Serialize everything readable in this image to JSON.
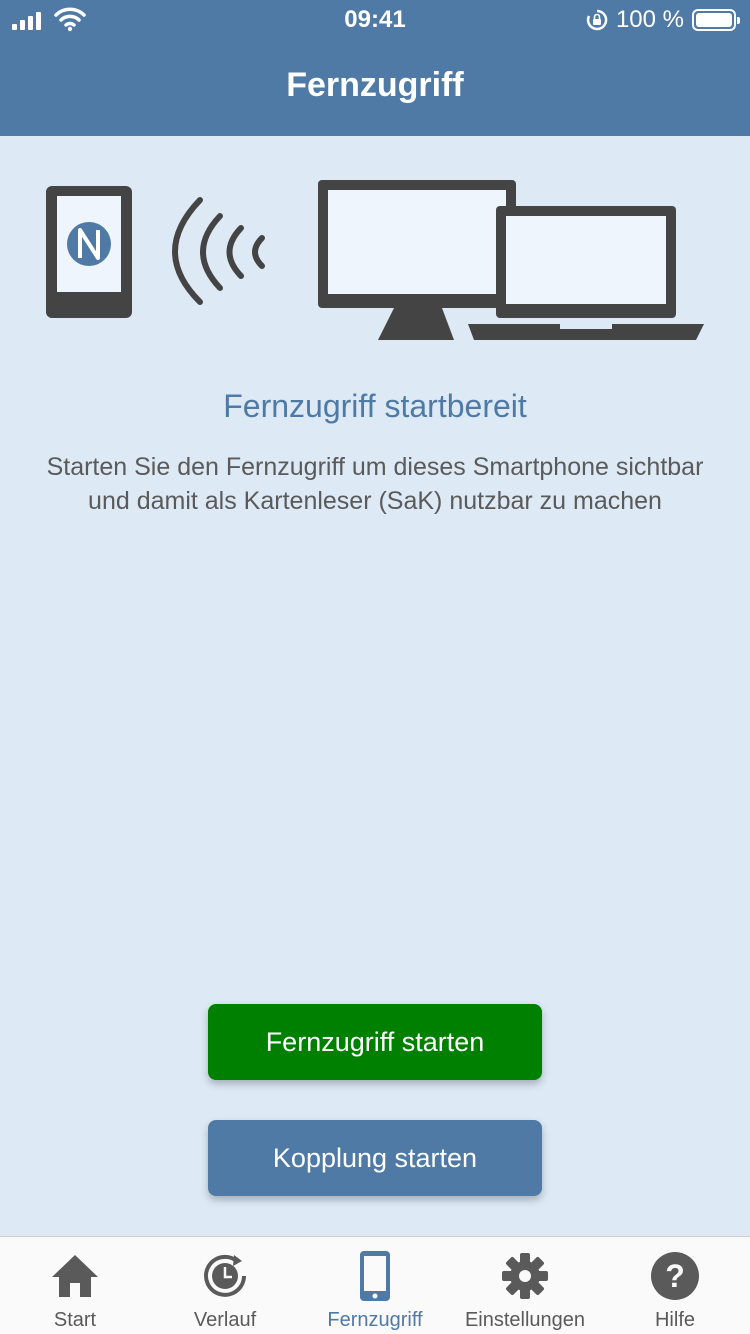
{
  "status_bar": {
    "time": "09:41",
    "battery_text": "100 %"
  },
  "header": {
    "title": "Fernzugriff"
  },
  "illustration": {
    "phone_icon": "nfc-phone-icon",
    "waves_icon": "wireless-waves-icon",
    "monitor_icon": "monitor-icon",
    "laptop_icon": "laptop-icon"
  },
  "main": {
    "heading": "Fernzugriff startbereit",
    "description": "Starten Sie den Fernzugriff um dieses Smartphone sichtbar und damit als Kartenleser (SaK) nutzbar zu machen"
  },
  "buttons": {
    "start_label": "Fernzugriff starten",
    "pair_label": "Kopplung starten"
  },
  "tabs": [
    {
      "label": "Start",
      "icon": "home-icon"
    },
    {
      "label": "Verlauf",
      "icon": "history-icon"
    },
    {
      "label": "Fernzugriff",
      "icon": "smartphone-icon",
      "active": true
    },
    {
      "label": "Einstellungen",
      "icon": "gear-icon"
    },
    {
      "label": "Hilfe",
      "icon": "help-icon"
    }
  ],
  "colors": {
    "primary": "#4f7aa6",
    "background": "#dde9f5",
    "start_button": "#008000",
    "text": "#5a5a5a",
    "icon_dark": "#444444"
  }
}
